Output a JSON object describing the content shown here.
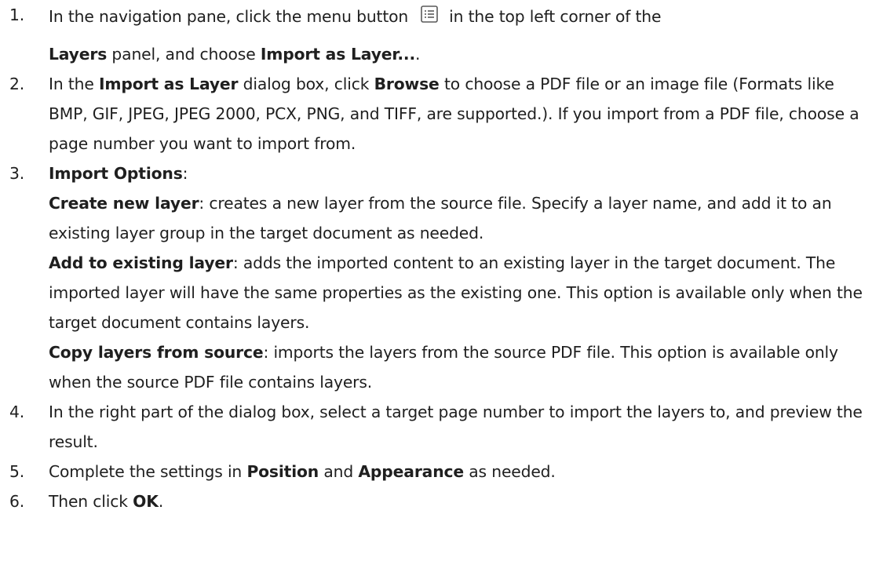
{
  "steps": [
    {
      "num": "1.",
      "line1_before": "In the navigation pane, click the menu button",
      "line1_after": "in the top left corner of the",
      "panel": "Layers",
      "mid": " panel, and choose ",
      "action": "Import as Layer...",
      "end": "."
    },
    {
      "num": "2.",
      "t1": "In the ",
      "dialog": "Import as Layer",
      "t2": " dialog box, click ",
      "browse": "Browse",
      "t3": " to choose a PDF file or an image file (Formats like BMP, GIF, JPEG, JPEG 2000, PCX, PNG, and TIFF, are supported.). If you import from a PDF file, choose a page number you want to import from."
    },
    {
      "num": "3.",
      "heading": "Import Options",
      "heading_end": ":",
      "options": [
        {
          "name": "Create new layer",
          "desc": ": creates a new layer from the source file. Specify a layer name, and add it to an existing layer group in the target document as needed."
        },
        {
          "name": "Add to existing layer",
          "desc": ": adds the imported content to an existing layer in the target document. The imported layer will have the same properties as the existing one. This option is available only when the target document contains layers."
        },
        {
          "name": "Copy layers from source",
          "desc": ": imports the layers from the source PDF file. This option is available only when the source PDF file contains layers."
        }
      ]
    },
    {
      "num": "4.",
      "text": "In the right part of the dialog box, select a target page number to import the layers to, and preview the result."
    },
    {
      "num": "5.",
      "t1": "Complete the settings in ",
      "position": "Position",
      "and": " and ",
      "appearance": "Appearance",
      "t2": " as needed."
    },
    {
      "num": "6.",
      "t1": "Then click ",
      "ok": "OK",
      "t2": "."
    }
  ],
  "icons": {
    "menu_button": "list-menu-icon"
  }
}
